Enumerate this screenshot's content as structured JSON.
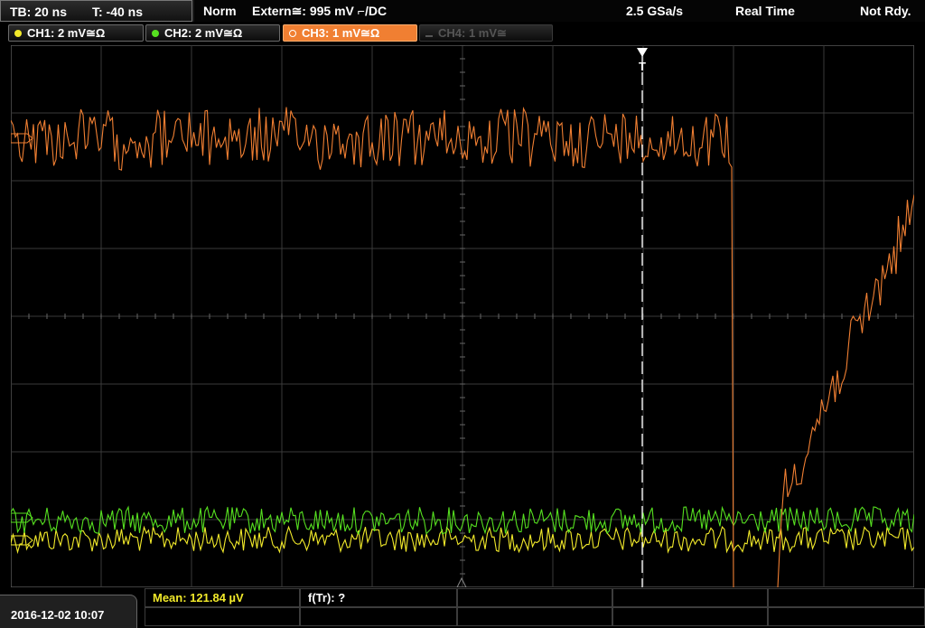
{
  "timebase": {
    "tb": "TB: 20 ns",
    "trig_pos": "T: -40 ns"
  },
  "status": {
    "mode": "Norm",
    "trigger": "Extern≅: 995 mV ⌐/DC",
    "sample_rate": "2.5 GSa/s",
    "acq": "Real Time",
    "state": "Not Rdy."
  },
  "channels": [
    {
      "label": "CH1: 2 mV≅Ω",
      "color": "#f2ea2a",
      "active": false,
      "enabled": true
    },
    {
      "label": "CH2: 2 mV≅Ω",
      "color": "#56e020",
      "active": false,
      "enabled": true
    },
    {
      "label": "CH3: 1 mV≅Ω",
      "color": "#f07f32",
      "active": true,
      "enabled": true
    },
    {
      "label": "CH4: 1 mV≅",
      "color": "#555555",
      "active": false,
      "enabled": false
    }
  ],
  "markers": {
    "trigger": "T"
  },
  "datetime": "2016-12-02 10:07",
  "measurements": [
    {
      "label": "Mean: 121.84 µV",
      "color": "#f2ea2a"
    },
    {
      "label": "f(Tr): ?",
      "color": "#ffffff"
    }
  ],
  "colors": {
    "ch1": "#f2ea2a",
    "ch2": "#56e020",
    "ch3": "#f07f32",
    "grid": "#3a3a3a",
    "trigger_line": "#ffffff"
  },
  "chart_data": {
    "type": "line",
    "x_divisions": 10,
    "y_divisions": 8,
    "grid": true,
    "series": [
      {
        "name": "CH1",
        "color": "#f2ea2a"
      },
      {
        "name": "CH2",
        "color": "#56e020"
      },
      {
        "name": "CH3",
        "color": "#f07f32"
      }
    ]
  }
}
